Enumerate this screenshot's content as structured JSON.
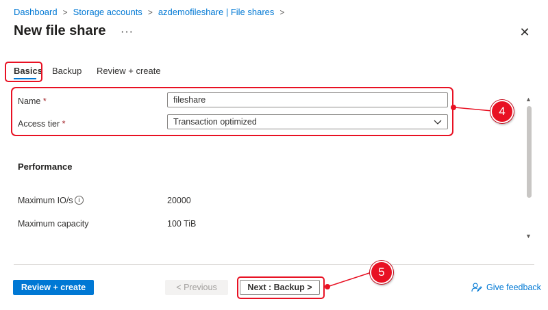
{
  "breadcrumb": {
    "items": [
      "Dashboard",
      "Storage accounts",
      "azdemofileshare | File shares"
    ],
    "separator": ">"
  },
  "header": {
    "title": "New file share",
    "more": "···",
    "close": "✕"
  },
  "tabs": [
    {
      "label": "Basics"
    },
    {
      "label": "Backup"
    },
    {
      "label": "Review + create"
    }
  ],
  "form": {
    "name_label": "Name",
    "name_value": "fileshare",
    "access_tier_label": "Access tier",
    "access_tier_value": "Transaction optimized",
    "required_mark": "*"
  },
  "performance": {
    "heading": "Performance",
    "max_io_label": "Maximum IO/s",
    "max_io_value": "20000",
    "max_capacity_label": "Maximum capacity",
    "max_capacity_value": "100 TiB"
  },
  "footer": {
    "review_create": "Review + create",
    "previous": "< Previous",
    "next": "Next : Backup >",
    "feedback": "Give feedback"
  },
  "callouts": {
    "four": "4",
    "five": "5"
  },
  "icons": {
    "info": "info-icon",
    "chevron": "chevron-down-icon",
    "feedback": "feedback-icon"
  },
  "colors": {
    "accent": "#0078d4",
    "highlight": "#e81123"
  }
}
